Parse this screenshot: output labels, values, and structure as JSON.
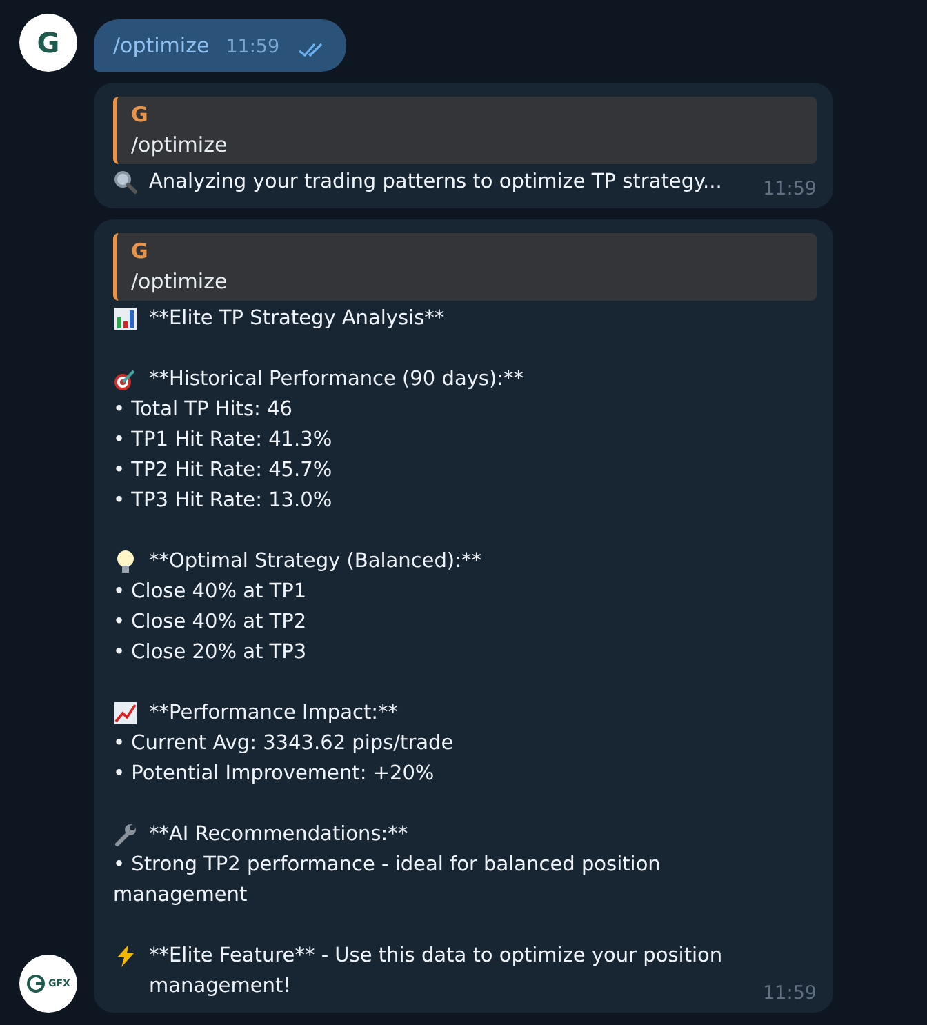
{
  "messages": [
    {
      "kind": "outgoing",
      "avatar": "G",
      "text": "/optimize",
      "time": "11:59",
      "read": true
    },
    {
      "kind": "reply",
      "reply_to": {
        "author": "G",
        "text": "/optimize"
      },
      "paragraphs": [
        {
          "kind": "magnifier",
          "lines": [
            "Analyzing your trading patterns to optimize TP strategy..."
          ]
        }
      ],
      "time": "11:59"
    },
    {
      "kind": "reply",
      "avatar": "GFX",
      "reply_to": {
        "author": "G",
        "text": "/optimize"
      },
      "paragraphs": [
        {
          "kind": "bar-chart",
          "lines": [
            "**Elite TP Strategy Analysis**"
          ]
        },
        {
          "kind": "target",
          "lines": [
            "**Historical Performance (90 days):**",
            "• Total TP Hits: 46",
            "• TP1 Hit Rate: 41.3%",
            "• TP2 Hit Rate: 45.7%",
            "• TP3 Hit Rate: 13.0%"
          ]
        },
        {
          "kind": "bulb",
          "lines": [
            "**Optimal Strategy (Balanced):**",
            "• Close 40% at TP1",
            "• Close 40% at TP2",
            "• Close 20% at TP3"
          ]
        },
        {
          "kind": "line-chart",
          "lines": [
            "**Performance Impact:**",
            "• Current Avg: 3343.62 pips/trade",
            "• Potential Improvement: +20%"
          ]
        },
        {
          "kind": "wrench",
          "lines": [
            "**AI Recommendations:**",
            "• Strong TP2 performance - ideal for balanced position management"
          ]
        },
        {
          "kind": "lightning",
          "lines": [
            "**Elite Feature** - Use this data to optimize your position management!"
          ]
        }
      ],
      "time": "11:59"
    }
  ]
}
